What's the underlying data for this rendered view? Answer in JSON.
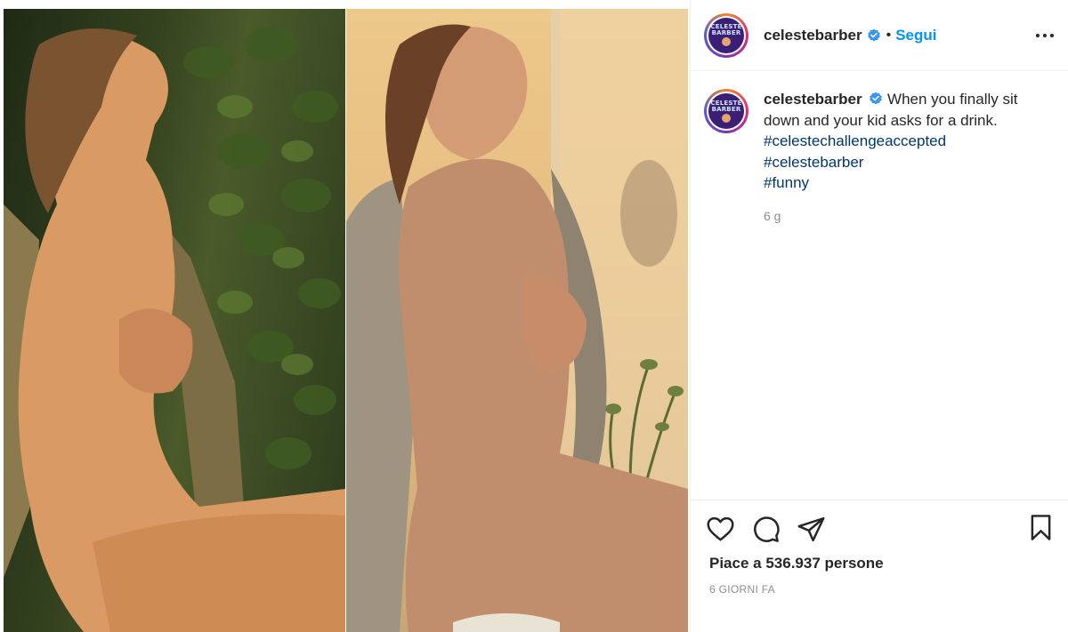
{
  "post": {
    "author": {
      "username": "celestebarber",
      "verified": true,
      "avatar_text_line1": "CELESTE",
      "avatar_text_line2": "BARBER"
    },
    "header": {
      "separator": "•",
      "follow_label": "Segui",
      "more_icon": "more-horizontal-icon"
    },
    "caption": {
      "text": "When you finally sit down and your kid asks for a drink.",
      "hashtags": [
        "#celestechallengeaccepted",
        "#celestebarber",
        "#funny"
      ],
      "time_ago": "6 g"
    },
    "actions": {
      "like_icon": "heart-icon",
      "comment_icon": "comment-icon",
      "share_icon": "paper-plane-icon",
      "save_icon": "bookmark-icon"
    },
    "likes_text": "Piace a 536.937 persone",
    "date_text": "6 GIORNI FA",
    "colors": {
      "link_blue": "#0095f6",
      "hashtag_blue": "#00376b",
      "verified_blue": "#3897f0",
      "muted_gray": "#8e8e8e",
      "text": "#262626"
    }
  }
}
